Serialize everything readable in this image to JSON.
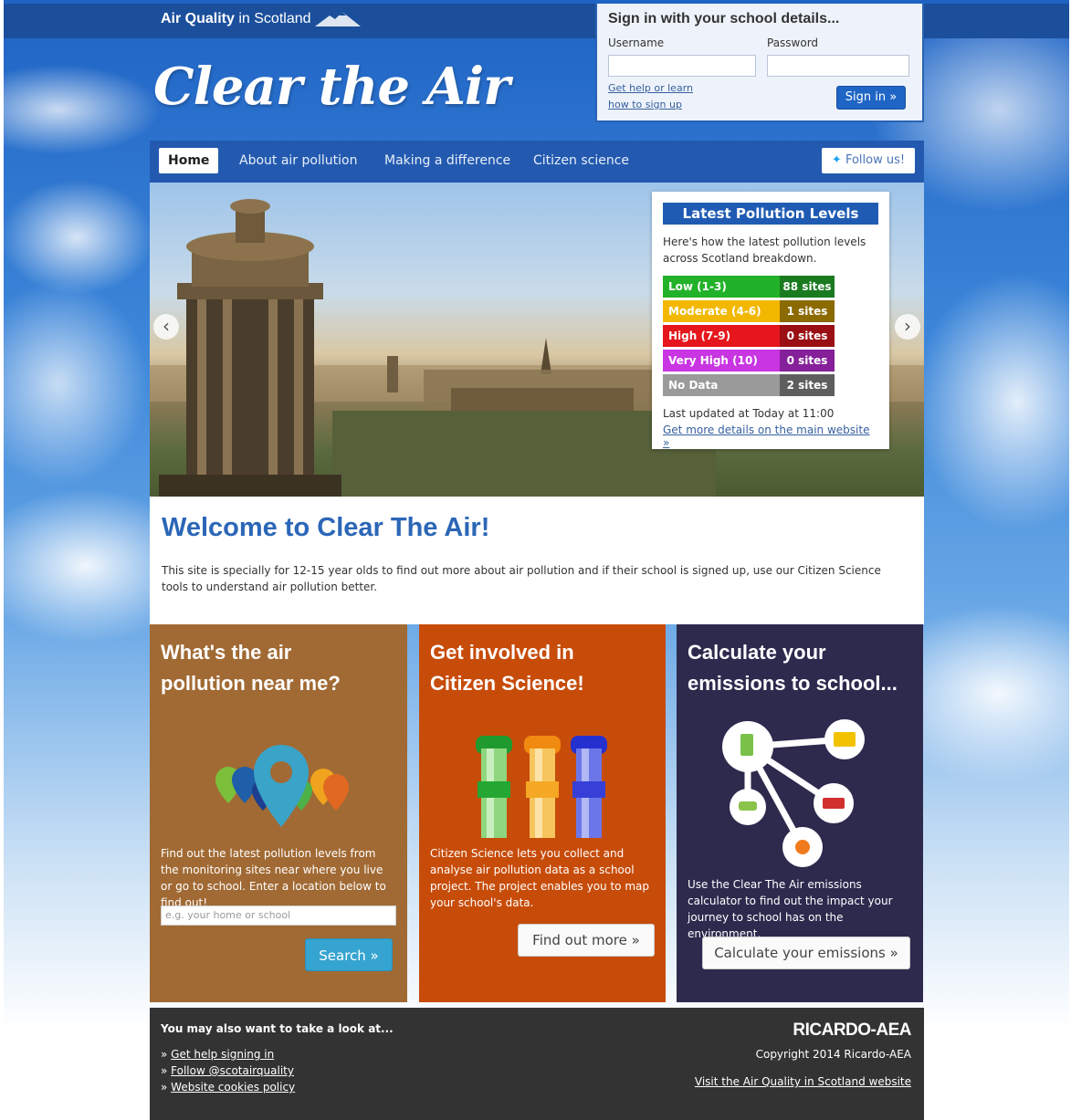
{
  "header": {
    "brand_bold": "Air Quality",
    "brand_rest": " in Scotland",
    "logo": "Clear the Air"
  },
  "signin": {
    "title": "Sign in with your school details...",
    "username_label": "Username",
    "password_label": "Password",
    "help_line1": "Get help or learn",
    "help_line2": "how to sign up",
    "button": "Sign in »"
  },
  "nav": {
    "items": [
      {
        "label": "Home"
      },
      {
        "label": "About air pollution"
      },
      {
        "label": "Making a difference"
      },
      {
        "label": "Citizen science"
      }
    ],
    "follow": "Follow us!"
  },
  "pollution": {
    "title": "Latest Pollution Levels",
    "intro": "Here's how the latest pollution levels across Scotland breakdown.",
    "levels": [
      {
        "name": "Low (1-3)",
        "count": "88 sites",
        "color": "#22b229",
        "count_color": "#1a7a20"
      },
      {
        "name": "Moderate (4-6)",
        "count": "1 sites",
        "color": "#f2b800",
        "count_color": "#8b6a00"
      },
      {
        "name": "High (7-9)",
        "count": "0 sites",
        "color": "#e5161c",
        "count_color": "#9a0f13"
      },
      {
        "name": "Very High (10)",
        "count": "0 sites",
        "color": "#c934e3",
        "count_color": "#86209a"
      },
      {
        "name": "No Data",
        "count": "2 sites",
        "color": "#9a9a9a",
        "count_color": "#5e5e5e"
      }
    ],
    "updated": "Last updated at Today at 11:00",
    "more_link": "Get more details on the main website »"
  },
  "welcome": {
    "title": "Welcome to Clear The Air!",
    "text": "This site is specially for 12-15 year olds to find out more about air pollution and if their school is signed up, use our Citizen Science tools to understand air pollution better."
  },
  "panels": {
    "near": {
      "title_line1": "What's the air",
      "title_line2": "pollution near me?",
      "text": "Find out the latest pollution levels from the monitoring sites near where you live or go to school. Enter a location below to find out!",
      "placeholder": "e.g. your home or school",
      "button": "Search »"
    },
    "citizen": {
      "title_line1": "Get involved in",
      "title_line2": "Citizen Science!",
      "text": "Citizen Science lets you collect and analyse air pollution data as a school project. The project enables you to map your school's data.",
      "button": "Find out more »"
    },
    "calc": {
      "title_line1": "Calculate your",
      "title_line2": "emissions to school...",
      "text": "Use the Clear The Air emissions calculator to find out the impact your journey to school has on the environment.",
      "button": "Calculate your emissions »"
    }
  },
  "footer": {
    "title": "You may also want to take a look at...",
    "links": [
      {
        "label": "Get help signing in"
      },
      {
        "label": "Follow @scotairquality"
      },
      {
        "label": "Website cookies policy"
      }
    ],
    "brand": "RICARDO-AEA",
    "copyright": "Copyright 2014 Ricardo-AEA",
    "visit": "Visit the Air Quality in Scotland website"
  },
  "colors": {
    "topbar": "#1b4f9c",
    "nav": "#235ab0",
    "near_panel": "#a16a34",
    "citizen_panel": "#c74c0a",
    "calc_panel": "#2d2a4e"
  }
}
